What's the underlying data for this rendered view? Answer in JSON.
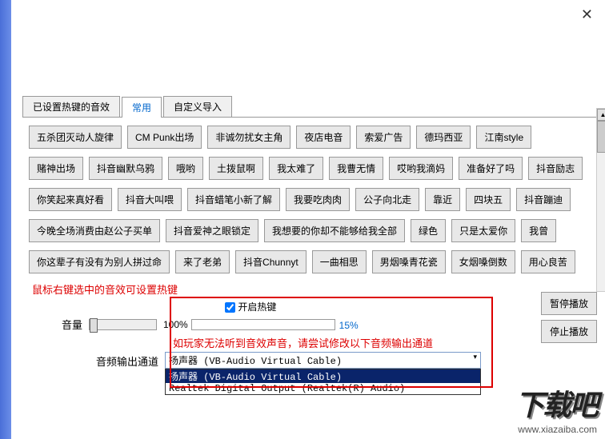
{
  "close_icon": "✕",
  "tabs": {
    "t0": "已设置热键的音效",
    "t1": "常用",
    "t2": "自定义导入"
  },
  "rows": {
    "r0": {
      "b0": "五杀团灭动人旋律",
      "b1": "CM Punk出场",
      "b2": "非诚勿扰女主角",
      "b3": "夜店电音",
      "b4": "索爱广告",
      "b5": "德玛西亚",
      "b6": "江南style"
    },
    "r1": {
      "b0": "赌神出场",
      "b1": "抖音幽默乌鸦",
      "b2": "哦哟",
      "b3": "土拨鼠啊",
      "b4": "我太难了",
      "b5": "我曹无情",
      "b6": "哎哟我滴妈",
      "b7": "准备好了吗",
      "b8": "抖音励志"
    },
    "r2": {
      "b0": "你笑起来真好看",
      "b1": "抖音大叫喂",
      "b2": "抖音蜡笔小新了解",
      "b3": "我要吃肉肉",
      "b4": "公子向北走",
      "b5": "靠近",
      "b6": "四块五",
      "b7": "抖音蹦迪"
    },
    "r3": {
      "b0": "今晚全场消费由赵公子买单",
      "b1": "抖音爱神之眼锁定",
      "b2": "我想要的你却不能够给我全部",
      "b3": "绿色",
      "b4": "只是太爱你",
      "b5": "我曾"
    },
    "r4": {
      "b0": "你这辈子有没有为别人拼过命",
      "b1": "来了老弟",
      "b2": "抖音Chunnyt",
      "b3": "一曲相思",
      "b4": "男烟嗓青花瓷",
      "b5": "女烟嗓倒数",
      "b6": "用心良苦"
    }
  },
  "hint1": "鼠标右键选中的音效可设置热键",
  "checkbox_label": "开启热键",
  "volume": {
    "label": "音量",
    "pct": "100%",
    "bar_pct": "15%",
    "fill_width": "27%"
  },
  "hint2": "如玩家无法听到音效声音，请尝试修改以下音频输出通道",
  "output": {
    "label": "音频输出通道",
    "selected": "扬声器 (VB-Audio Virtual Cable)",
    "opt0": "扬声器 (VB-Audio Virtual Cable)",
    "opt1": "Realtek Digital Output (Realtek(R) Audio)"
  },
  "pause": "暂停播放",
  "stop": "停止播放",
  "wm_logo": "下载吧",
  "wm_url": "www.xiazaiba.com"
}
